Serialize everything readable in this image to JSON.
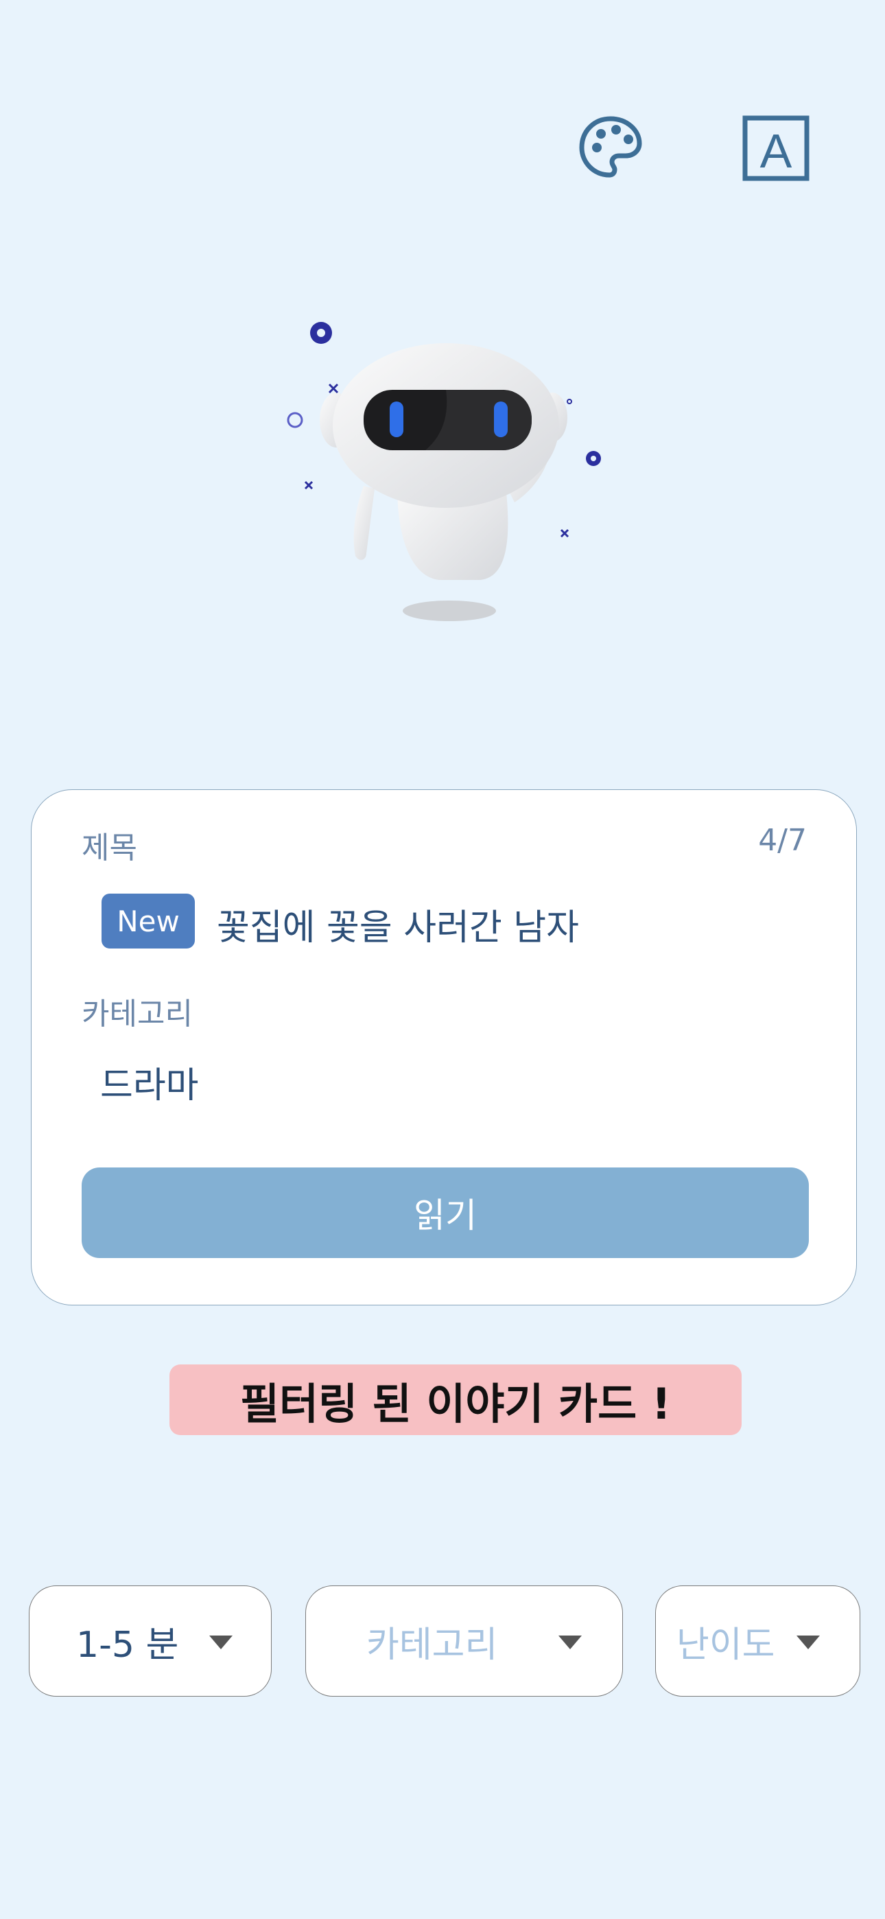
{
  "header": {
    "palette_icon": "palette-icon",
    "font_icon": "font-size-icon",
    "font_icon_letter": "A",
    "icon_color": "#3d6e96"
  },
  "card": {
    "title_label": "제목",
    "counter": "4/7",
    "new_badge": "New",
    "story_title": "꽃집에 꽃을 사러간 남자",
    "category_label": "카테고리",
    "category_value": "드라마",
    "read_button": "읽기"
  },
  "banner": {
    "text": "필터링 된 이야기 카드 !"
  },
  "filters": {
    "time": "1-5 분",
    "category": "카테고리",
    "level": "난이도"
  },
  "colors": {
    "background": "#e8f3fc",
    "accent": "#4f7ec0",
    "button": "#83b0d3",
    "banner": "#f7c0c3"
  }
}
